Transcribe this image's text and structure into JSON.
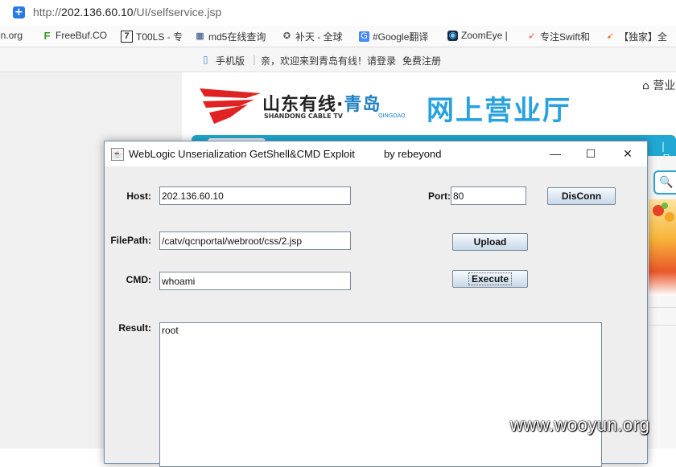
{
  "browser": {
    "url_prefix": "http://",
    "url_host": "202.136.60.10",
    "url_path": "/UI/selfservice.jsp",
    "bookmarks": [
      {
        "label": "un.org",
        "icon": "globe-icon"
      },
      {
        "label": "FreeBuf.CO",
        "icon": "freebuf-icon"
      },
      {
        "label": "T00LS - 专",
        "icon": "t00ls-icon"
      },
      {
        "label": "md5在线查询",
        "icon": "grid-icon"
      },
      {
        "label": "补天 - 全球",
        "icon": "butian-icon"
      },
      {
        "label": "#Google翻译",
        "icon": "translate-icon"
      },
      {
        "label": "ZoomEye |",
        "icon": "eye-icon"
      },
      {
        "label": "专注Swift和",
        "icon": "swift-icon"
      },
      {
        "label": "【独家】全",
        "icon": "bird-icon"
      }
    ]
  },
  "site": {
    "topbar": {
      "mobile": "手机版",
      "welcome": "亲，欢迎来到青岛有线！请",
      "login": "登录",
      "register": "免费注册"
    },
    "logo_cn_main": "山东有线·",
    "logo_cn_city": "青岛",
    "logo_en": "SHANDONG CABLE TV",
    "logo_en_city": "QINGDAO",
    "hall_title": "网上营业厅",
    "home_link": "营业",
    "nav_right": "品"
  },
  "window": {
    "title": "WebLogic Unserialization GetShell&CMD Exploit          by rebeyond",
    "host_label": "Host:",
    "host_value": "202.136.60.10",
    "port_label": "Port:",
    "port_value": "80",
    "disconn_label": "DisConn",
    "filepath_label": "FilePath:",
    "filepath_value": "/catv/qcnportal/webroot/css/2.jsp",
    "upload_label": "Upload",
    "cmd_label": "CMD:",
    "cmd_value": "whoami",
    "execute_label": "Execute",
    "result_label": "Result:",
    "result_value": "root"
  },
  "watermark": "www.wooyun.org"
}
